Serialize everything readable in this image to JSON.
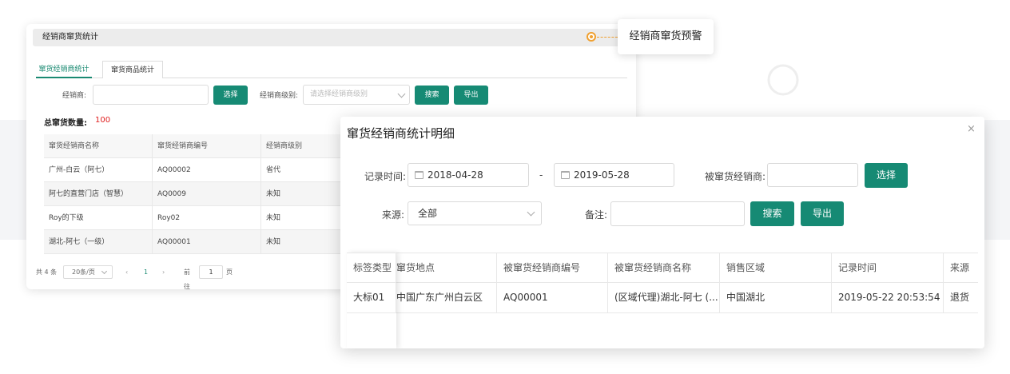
{
  "callout": {
    "text": "经销商窜货预警"
  },
  "back_panel": {
    "header_title": "经销商窜货统计",
    "tabs": [
      {
        "label": "窜货经销商统计",
        "active": true
      },
      {
        "label": "窜货商品统计",
        "active": false
      }
    ],
    "filters": {
      "dealer_label": "经销商:",
      "dealer_value": "",
      "select_button": "选择",
      "level_label": "经销商级别:",
      "level_placeholder": "请选择经销商级别",
      "search_button": "搜索",
      "export_button": "导出"
    },
    "total_label": "总窜货数量:",
    "total_value": "100",
    "table": {
      "columns": [
        "窜货经销商名称",
        "窜货经销商编号",
        "经销商级别"
      ],
      "rows": [
        [
          "广州-白云（阿七）",
          "AQ00002",
          "省代"
        ],
        [
          "阿七的直营门店（智慧）",
          "AQ0009",
          "未知"
        ],
        [
          "Roy的下级",
          "Roy02",
          "未知"
        ],
        [
          "湖北-阿七（一级）",
          "AQ00001",
          "未知"
        ]
      ]
    },
    "pagination": {
      "total_text": "共 4 条",
      "page_size": "20条/页",
      "prev": "‹",
      "current_page": "1",
      "next": "›",
      "goto_label": "前往",
      "goto_value": "1",
      "page_suffix": "页"
    }
  },
  "dialog": {
    "title": "窜货经销商统计明细",
    "close": "×",
    "record_time_label": "记录时间:",
    "start_date": "2018-04-28",
    "date_separator": "-",
    "end_date": "2019-05-28",
    "target_dealer_label": "被窜货经销商:",
    "target_dealer_value": "",
    "select_button": "选择",
    "source_label": "来源:",
    "source_value": "全部",
    "remark_label": "备注:",
    "remark_value": "",
    "search_button": "搜索",
    "export_button": "导出",
    "table": {
      "columns": [
        "标签类型",
        "窜货地点",
        "被窜货经销商编号",
        "被窜货经销商名称",
        "销售区域",
        "记录时间",
        "来源"
      ],
      "rows": [
        [
          "大标01",
          "中国广东广州白云区",
          "AQ00001",
          "(区域代理)湖北-阿七 (...",
          "中国湖北",
          "2019-05-22 20:53:54",
          "退货"
        ]
      ]
    }
  },
  "colors": {
    "primary": "#168a74",
    "accent": "#f0a030",
    "total_value": "#e02020"
  }
}
